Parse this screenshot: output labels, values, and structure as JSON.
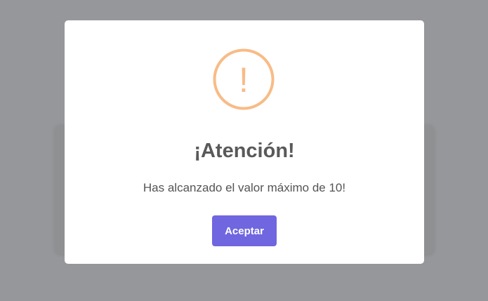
{
  "alert": {
    "icon": "warning-icon",
    "icon_symbol": "!",
    "title": "¡Atención!",
    "message": "Has alcanzado el valor máximo de 10!",
    "confirm_label": "Aceptar"
  },
  "colors": {
    "backdrop": "#96979a",
    "icon": "#f8bb86",
    "confirm_button": "#7066e0",
    "title_text": "#595959"
  }
}
